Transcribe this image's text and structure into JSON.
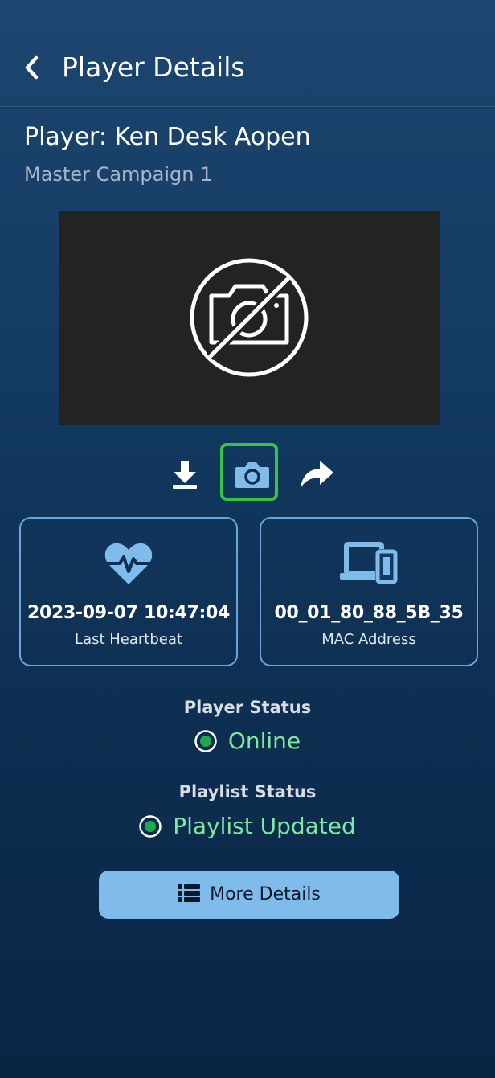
{
  "header": {
    "title": "Player Details",
    "back_icon": "chevron-left-icon"
  },
  "player": {
    "name": "Player: Ken Desk Aopen",
    "campaign": "Master Campaign 1"
  },
  "preview": {
    "icon": "no-camera-icon"
  },
  "toolbar": {
    "download_icon": "download-icon",
    "screenshot_icon": "camera-icon",
    "share_icon": "share-icon",
    "highlight_color": "#35c545"
  },
  "cards": {
    "heartbeat": {
      "icon": "heartbeat-icon",
      "value": "2023-09-07 10:47:04",
      "label": "Last Heartbeat"
    },
    "mac": {
      "icon": "devices-icon",
      "value": "00_01_80_88_5B_35",
      "label": "MAC Address"
    }
  },
  "player_status": {
    "heading": "Player Status",
    "value": "Online",
    "color": "#7ee8a0"
  },
  "playlist_status": {
    "heading": "Playlist Status",
    "value": "Playlist Updated",
    "color": "#7ee8a0"
  },
  "more_details": {
    "label": "More Details",
    "icon": "list-icon"
  },
  "colors": {
    "accent": "#7fbcec",
    "card_border": "#6aa6d8",
    "status_green": "#1faa4f"
  }
}
